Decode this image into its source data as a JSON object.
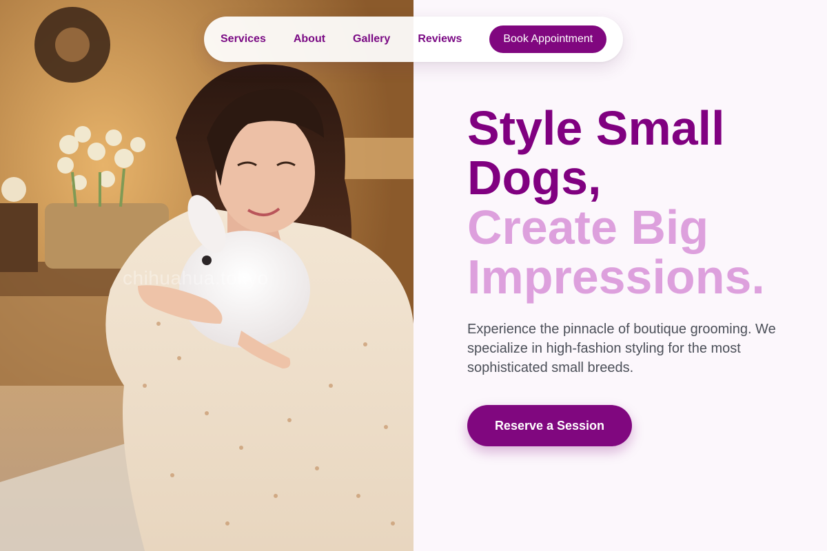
{
  "nav": {
    "links": [
      {
        "label": "Services"
      },
      {
        "label": "About"
      },
      {
        "label": "Gallery"
      },
      {
        "label": "Reviews"
      }
    ],
    "cta_label": "Book Appointment"
  },
  "hero": {
    "headline_dark": [
      "Style Small",
      "Dogs,"
    ],
    "headline_light": [
      "Create Big",
      "Impressions."
    ],
    "description": "Experience the pinnacle of boutique grooming. We specialize in high-fashion styling for the most sophisticated small breeds.",
    "button_label": "Reserve a Session",
    "photo_watermark": "chihuahua.tokyo"
  },
  "colors": {
    "brand_purple": "#800080",
    "accent_lilac": "#dda0dd",
    "button_purple": "#80077f",
    "text_gray": "#4b4f58",
    "page_background": "#fcf7fc"
  }
}
